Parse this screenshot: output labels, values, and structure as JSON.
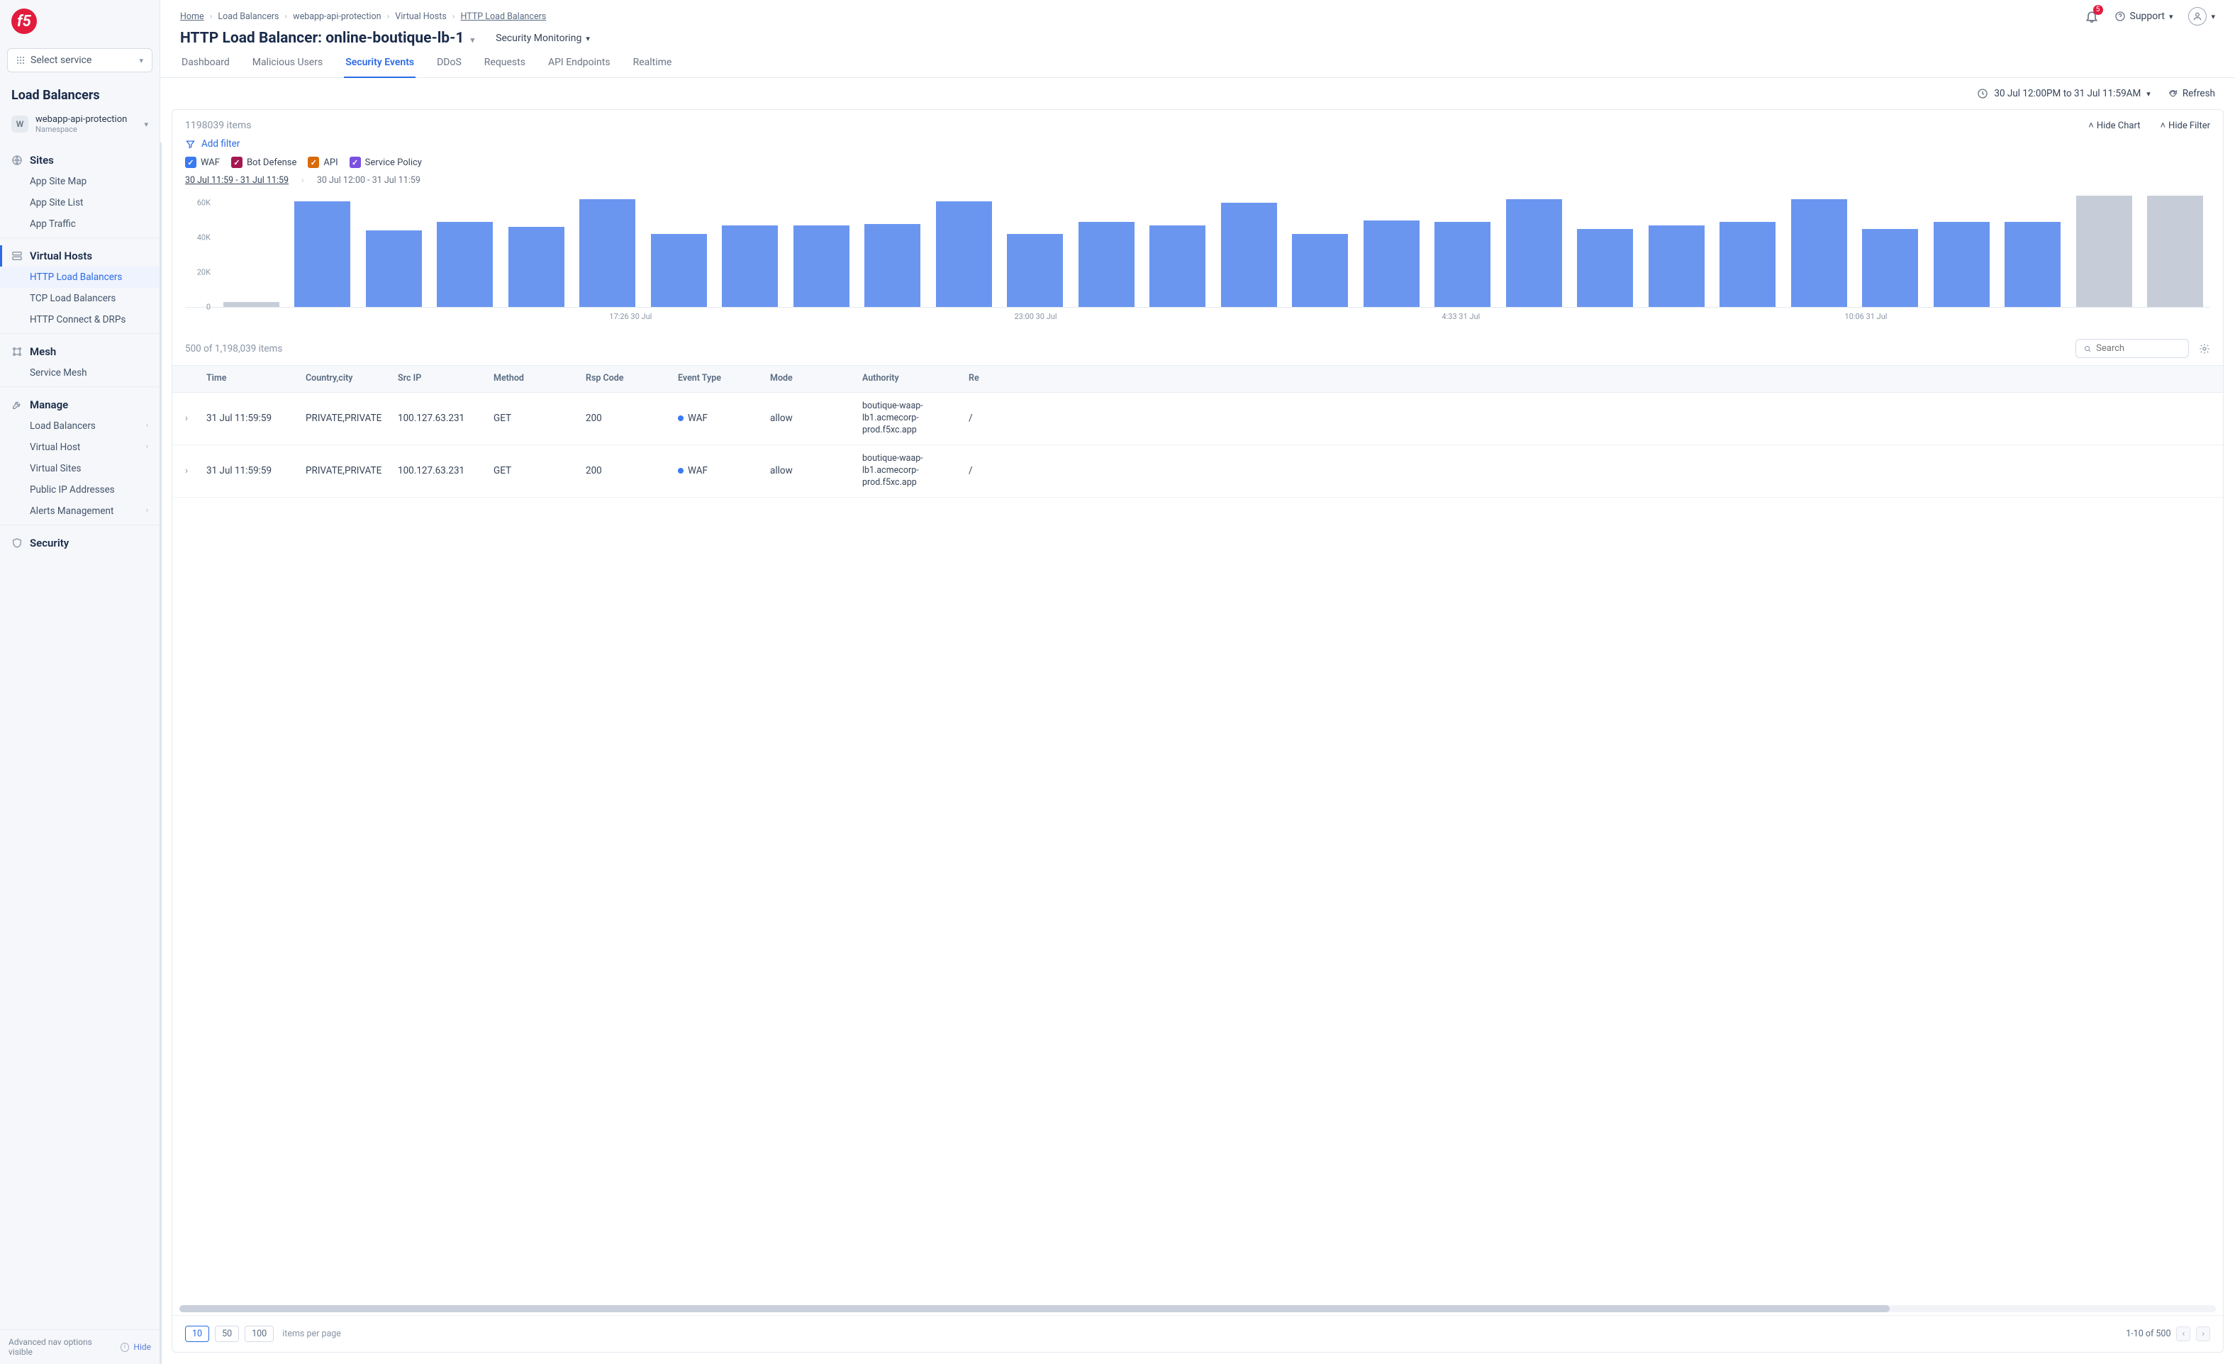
{
  "logo": "f5",
  "select_service": "Select service",
  "sidebar_title": "Load Balancers",
  "namespace": {
    "letter": "W",
    "name": "webapp-api-protection",
    "sub": "Namespace"
  },
  "nav": {
    "sites": {
      "label": "Sites",
      "items": [
        "App Site Map",
        "App Site List",
        "App Traffic"
      ]
    },
    "vhosts": {
      "label": "Virtual Hosts",
      "items": [
        "HTTP Load Balancers",
        "TCP Load Balancers",
        "HTTP Connect & DRPs"
      ],
      "active_idx": 0
    },
    "mesh": {
      "label": "Mesh",
      "items": [
        "Service Mesh"
      ]
    },
    "manage": {
      "label": "Manage",
      "items": [
        "Load Balancers",
        "Virtual Host",
        "Virtual Sites",
        "Public IP Addresses",
        "Alerts Management"
      ],
      "chev": [
        true,
        true,
        false,
        false,
        true
      ]
    },
    "security": {
      "label": "Security"
    }
  },
  "bottom_note": {
    "text": "Advanced nav options visible",
    "hide": "Hide"
  },
  "breadcrumbs": [
    "Home",
    "Load Balancers",
    "webapp-api-protection",
    "Virtual Hosts",
    "HTTP Load Balancers"
  ],
  "page_title": "HTTP Load Balancer: online-boutique-lb-1",
  "sec_mon": "Security Monitoring",
  "notif_badge": "5",
  "support": "Support",
  "tabs": [
    "Dashboard",
    "Malicious Users",
    "Security Events",
    "DDoS",
    "Requests",
    "API Endpoints",
    "Realtime"
  ],
  "active_tab": 2,
  "time_range": "30 Jul 12:00PM to 31 Jul 11:59AM",
  "refresh": "Refresh",
  "items_count": "1198039 items",
  "hide_chart": "Hide Chart",
  "hide_filter": "Hide Filter",
  "add_filter": "Add filter",
  "chips": [
    {
      "label": "WAF",
      "color": "#3a7af2"
    },
    {
      "label": "Bot Defense",
      "color": "#a4184f"
    },
    {
      "label": "API",
      "color": "#d86a0a"
    },
    {
      "label": "Service Policy",
      "color": "#7a50e0"
    }
  ],
  "date_tabs": {
    "active": "30 Jul 11:59 - 31 Jul 11:59",
    "inactive": "30 Jul 12:00 - 31 Jul 11:59"
  },
  "chart_data": {
    "type": "bar",
    "ylabel": "",
    "ylim": [
      0,
      65000
    ],
    "y_ticks": [
      {
        "v": 0,
        "l": "0"
      },
      {
        "v": 20000,
        "l": "20K"
      },
      {
        "v": 40000,
        "l": "40K"
      },
      {
        "v": 60000,
        "l": "60K"
      }
    ],
    "x_labels": [
      {
        "pos": 22,
        "l": "17:26 30 Jul"
      },
      {
        "pos": 42,
        "l": "23:00 30 Jul"
      },
      {
        "pos": 63,
        "l": "4:33 31 Jul"
      },
      {
        "pos": 83,
        "l": "10:06 31 Jul"
      }
    ],
    "bars": [
      {
        "v": 3000,
        "type": "gray"
      },
      {
        "v": 61000,
        "type": "blue"
      },
      {
        "v": 44000,
        "type": "blue"
      },
      {
        "v": 49000,
        "type": "blue"
      },
      {
        "v": 46000,
        "type": "blue"
      },
      {
        "v": 62000,
        "type": "blue"
      },
      {
        "v": 42000,
        "type": "blue"
      },
      {
        "v": 47000,
        "type": "blue"
      },
      {
        "v": 47000,
        "type": "blue"
      },
      {
        "v": 48000,
        "type": "blue"
      },
      {
        "v": 61000,
        "type": "blue"
      },
      {
        "v": 42000,
        "type": "blue"
      },
      {
        "v": 49000,
        "type": "blue"
      },
      {
        "v": 47000,
        "type": "blue"
      },
      {
        "v": 60000,
        "type": "blue"
      },
      {
        "v": 42000,
        "type": "blue"
      },
      {
        "v": 50000,
        "type": "blue"
      },
      {
        "v": 49000,
        "type": "blue"
      },
      {
        "v": 62000,
        "type": "blue"
      },
      {
        "v": 45000,
        "type": "blue"
      },
      {
        "v": 47000,
        "type": "blue"
      },
      {
        "v": 49000,
        "type": "blue"
      },
      {
        "v": 62000,
        "type": "blue"
      },
      {
        "v": 45000,
        "type": "blue"
      },
      {
        "v": 49000,
        "type": "blue"
      },
      {
        "v": 49000,
        "type": "blue"
      },
      {
        "v": 64000,
        "type": "gray"
      },
      {
        "v": 64000,
        "type": "gray"
      }
    ]
  },
  "table": {
    "count": "500 of 1,198,039 items",
    "headers": [
      "Time",
      "Country,city",
      "Src IP",
      "Method",
      "Rsp Code",
      "Event Type",
      "Mode",
      "Authority",
      "Re"
    ],
    "search_ph": "Search",
    "rows": [
      {
        "time": "31 Jul 11:59:59",
        "cc": "PRIVATE,PRIVATE",
        "src": "100.127.63.231",
        "method": "GET",
        "rsp": "200",
        "evt": "WAF",
        "mode": "allow",
        "auth": "boutique-waap-lb1.acmecorp-prod.f5xc.app",
        "re": "/"
      },
      {
        "time": "31 Jul 11:59:59",
        "cc": "PRIVATE,PRIVATE",
        "src": "100.127.63.231",
        "method": "GET",
        "rsp": "200",
        "evt": "WAF",
        "mode": "allow",
        "auth": "boutique-waap-lb1.acmecorp-prod.f5xc.app",
        "re": "/"
      }
    ]
  },
  "pager": {
    "sizes": [
      "10",
      "50",
      "100"
    ],
    "active_size": 0,
    "label": "items per page",
    "range": "1-10 of 500"
  }
}
